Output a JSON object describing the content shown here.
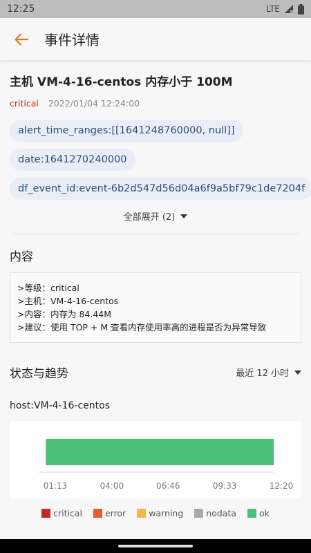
{
  "status_bar": {
    "time": "12:25",
    "network": "LTE"
  },
  "header": {
    "title": "事件详情"
  },
  "event": {
    "title": "主机 VM-4-16-centos 内存小于 100M",
    "level": "critical",
    "timestamp": "2022/01/04 12:24:00",
    "tags": [
      "alert_time_ranges:[[1641248760000, null]]",
      "date:1641270240000",
      "df_event_id:event-6b2d547d56d04a6f9a5bf79c1de7204f"
    ],
    "expand_label": "全部展开 (2)"
  },
  "content_section": {
    "heading": "内容",
    "lines": [
      ">等级：critical",
      ">主机：VM-4-16-centos",
      ">内容：内存为 84.44M",
      ">建议：使用 TOP + M 查看内存使用率高的进程是否为异常导致"
    ]
  },
  "trend_section": {
    "heading": "状态与趋势",
    "range_label": "最近 12 小时",
    "host_label": "host:VM-4-16-centos"
  },
  "chart_data": {
    "type": "bar",
    "x_ticks": [
      "01:13",
      "04:00",
      "06:46",
      "09:33",
      "12:20"
    ],
    "segments": [
      {
        "status": "ok",
        "from": "00:45",
        "to": "12:25"
      }
    ],
    "legend": [
      {
        "name": "critical",
        "color": "#c62828"
      },
      {
        "name": "error",
        "color": "#e65c2e"
      },
      {
        "name": "warning",
        "color": "#f5b84f"
      },
      {
        "name": "nodata",
        "color": "#a8a8a8"
      },
      {
        "name": "ok",
        "color": "#4cc078"
      }
    ]
  },
  "colors": {
    "accent": "#e8762d",
    "tag_bg": "#e9eef6",
    "tag_text": "#2c4d7d"
  }
}
